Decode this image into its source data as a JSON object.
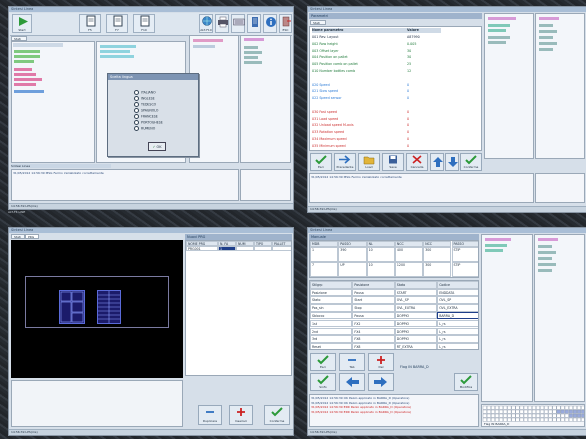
{
  "windows": {
    "tl": {
      "title": "Sintesi Linea",
      "toolbar": [
        {
          "label": "Start",
          "key": "F1",
          "icon": "play-icon"
        },
        {
          "label": "Presenze",
          "key": "F5",
          "icon": "document-icon"
        },
        {
          "label": "Parametri",
          "key": "F7",
          "icon": "document-icon"
        },
        {
          "label": "Manuale",
          "key": "F10",
          "icon": "document-icon"
        }
      ],
      "right_icons": [
        {
          "label": "ALT-F10",
          "icon": "globe-icon"
        },
        {
          "label": "",
          "icon": "printer-icon"
        },
        {
          "label": "",
          "icon": "keyboard-icon"
        },
        {
          "label": "",
          "icon": "list-icon"
        },
        {
          "label": "",
          "icon": "info-icon"
        },
        {
          "label": "ESC",
          "icon": "exit-icon"
        }
      ],
      "tab": "Stati",
      "status_left": "Sintesi Linea",
      "log_line": "31/05/2012  14:56:39  MSG  Fermo inizializzato correttamente",
      "bottom_info": "ALT-F4  LINE",
      "taskbar": "14:56:39  LPS(ms)"
    },
    "tr": {
      "title": "Sintesi Linea",
      "panel_title": "Parametri",
      "tab": "Stati",
      "header_col1": "Nome parametro",
      "header_col2": "Valore",
      "rows": [
        {
          "label": "001 Rev. Layout",
          "value": "A87990",
          "color": "#1f2f44"
        },
        {
          "label": "002 Row height",
          "value": "0.005",
          "color": "#1f7a3a"
        },
        {
          "label": "003 Offset layer",
          "value": "30",
          "color": "#1f7a3a"
        },
        {
          "label": "004 Position on pallet",
          "value": "30",
          "color": "#1f7a3a"
        },
        {
          "label": "005 Position comb on pallet",
          "value": "25",
          "color": "#1f7a3a"
        },
        {
          "label": "010 Number bottles comb",
          "value": "12",
          "color": "#1f7a3a"
        },
        {
          "label": "",
          "value": "",
          "color": "#1f7a3a"
        },
        {
          "label": "020 Speed",
          "value": "0",
          "color": "#2a7ad6"
        },
        {
          "label": "021 Slow speed",
          "value": "0",
          "color": "#2a7ad6"
        },
        {
          "label": "022 Speed sensor",
          "value": "0",
          "color": "#2a7ad6"
        },
        {
          "label": "",
          "value": "",
          "color": "#2a7ad6"
        },
        {
          "label": "030 Fast speed",
          "value": "0",
          "color": "#cc2e2e"
        },
        {
          "label": "031 Load speed",
          "value": "0",
          "color": "#cc2e2e"
        },
        {
          "label": "032 Unload speed M-axis",
          "value": "0",
          "color": "#cc2e2e"
        },
        {
          "label": "033 Rotation speed",
          "value": "0",
          "color": "#cc2e2e"
        },
        {
          "label": "034 Maximum speed",
          "value": "0",
          "color": "#cc2e2e"
        },
        {
          "label": "035 Minimum speed",
          "value": "0",
          "color": "#cc2e2e"
        }
      ],
      "buttons": [
        {
          "label": "Esci",
          "key": "ESC"
        },
        {
          "label": "Precedente",
          "key": "F2"
        },
        {
          "label": "Load",
          "key": "F3"
        },
        {
          "label": "Save",
          "key": "F4"
        },
        {
          "label": "Cancella",
          "key": "F5"
        },
        {
          "label": "",
          "key": ""
        },
        {
          "label": "",
          "key": ""
        },
        {
          "label": "Conferma",
          "key": "F10"
        }
      ],
      "log_line": "31/05/2012  14:56:39  MSG  Fermo inizializzato correttamente",
      "taskbar": "14:56:39  LPS(ms)"
    },
    "bl": {
      "title": "Sintesi Linea",
      "tabs": [
        "Stati",
        "PRG"
      ],
      "panel_title": "Nuovi PRG",
      "columns": [
        "NOME PRG",
        "N. FA",
        "NUM",
        "TIPO",
        "PALLET"
      ],
      "row": [
        "PRG001",
        "1",
        "",
        "",
        ""
      ],
      "buttons": [
        {
          "label": "Duplicare",
          "key": "F2"
        },
        {
          "label": "Inserisci",
          "key": "F3"
        },
        {
          "label": "Conferma",
          "key": "F10"
        }
      ],
      "taskbar": "14:56:39  LPS(ms)"
    },
    "br": {
      "title": "Sintesi Linea",
      "panel_title": "Manuale",
      "grid_header": [
        "MDB",
        "PASSO",
        "NL",
        "NCC",
        "NCC",
        "PASSO"
      ],
      "grid_rows": [
        [
          "1",
          "390",
          "10",
          "400",
          "300",
          "STIP"
        ],
        [
          "7",
          "UP",
          "10",
          "1200",
          "300",
          "STIP"
        ]
      ],
      "table_header": [
        "Stilgrp",
        "Posizione",
        "Stato",
        "Codice"
      ],
      "table_rows": [
        [
          "Posizione",
          "Pausa",
          "START",
          "ENDDATA"
        ],
        [
          "Stato",
          "Start",
          "OVL_SP",
          "OVL_SP"
        ],
        [
          "Pos_sin",
          "Stop",
          "OVL_EXTRA",
          "OVL_EXTRA"
        ],
        [
          "Sblocco",
          "Pausa",
          "DOPPIO",
          "BARRA_D"
        ],
        [
          "1st",
          "FX2",
          "DOPPIO",
          "L_rs"
        ],
        [
          "2nd",
          "FX4",
          "DOPPIO",
          "L_rs"
        ],
        [
          "3rd",
          "FX8",
          "DOPPIO",
          "L_rs"
        ],
        [
          "Reset",
          "FX8",
          "RT_EXTRA",
          "L_rs"
        ]
      ],
      "buttons": [
        {
          "label": "Esci",
          "key": "ESC"
        },
        {
          "label": "Tab",
          "key": "F2"
        },
        {
          "label": "Del",
          "key": "F3"
        },
        {
          "label": "Ins",
          "key": "F4"
        },
        {
          "label": "Sinfo",
          "key": "F5"
        },
        {
          "label": "",
          "key": ""
        },
        {
          "label": "",
          "key": ""
        },
        {
          "label": "Modifica",
          "key": "F10"
        }
      ],
      "flag_text": "Flag IN  BARRA_D",
      "flag_text2": "Flag IN  BARRA_D",
      "log_lines": [
        "31/05/2012  14:56:39  OK  Pezzo applicato in BARRA_D (Operatore)",
        "31/05/2012  14:56:39  OK  Pezzo applicato in BARRA_D (Operatore)",
        "31/05/2012  14:56:39  ERR  Pezzo applicato in BARRA_D (Operatore)",
        "31/05/2012  14:56:39  ERR  Pezzo applicato in BARRA_D (Operatore)"
      ],
      "taskbar": "14:56:39  LPS(ms)",
      "flag_small": "Flag IN  BARRA_D"
    }
  },
  "dialog": {
    "title": "Scelta lingua",
    "options": [
      "ITALIANO",
      "INGLESE",
      "TEDESCO",
      "SPAGNOLO",
      "FRANCESE",
      "PORTOGHESE",
      "RUMENO"
    ],
    "ok_label": "OK"
  },
  "colors": {
    "accent": "#2f6fbf",
    "green": "#1f7a3a",
    "red": "#cc2e2e",
    "blue_text": "#2a7ad6",
    "cyan": "#2bb5c4",
    "magenta": "#d02ad0"
  }
}
